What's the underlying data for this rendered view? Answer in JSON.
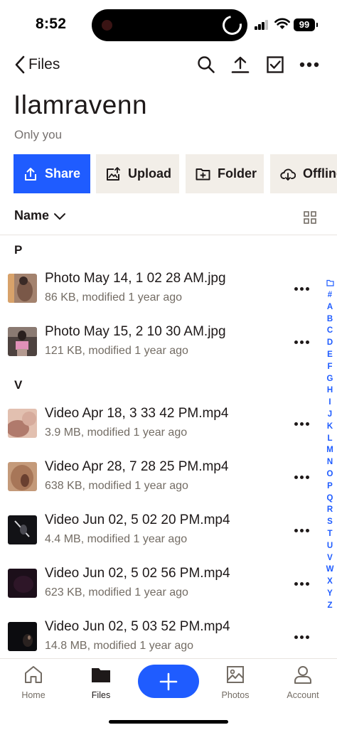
{
  "status_bar": {
    "time": "8:52",
    "battery": "99"
  },
  "nav": {
    "back_label": "Files"
  },
  "folder": {
    "title": "Ilamravenn",
    "subtitle": "Only you"
  },
  "actions": [
    {
      "label": "Share",
      "icon": "share-icon"
    },
    {
      "label": "Upload",
      "icon": "upload-image-icon"
    },
    {
      "label": "Folder",
      "icon": "new-folder-icon"
    },
    {
      "label": "Offline",
      "icon": "offline-download-icon"
    }
  ],
  "sort": {
    "label": "Name"
  },
  "sections": [
    {
      "letter": "P"
    },
    {
      "letter": "V"
    }
  ],
  "files": [
    {
      "name": "Photo May 14, 1 02 28 AM.jpg",
      "meta": "86 KB, modified 1 year ago",
      "thumb_color": "#a3826e"
    },
    {
      "name": "Photo May 15, 2 10 30 AM.jpg",
      "meta": "121 KB, modified 1 year ago",
      "thumb_color": "#6b5a55"
    },
    {
      "name": "Video Apr 18, 3 33 42 PM.mp4",
      "meta": "3.9 MB, modified 1 year ago",
      "thumb_color": "#c39a8a"
    },
    {
      "name": "Video Apr 28, 7 28 25 PM.mp4",
      "meta": "638 KB, modified 1 year ago",
      "thumb_color": "#b58a6c"
    },
    {
      "name": "Video Jun 02, 5 02 20 PM.mp4",
      "meta": "4.4 MB, modified 1 year ago",
      "thumb_color": "#1b1b1f"
    },
    {
      "name": "Video Jun 02, 5 02 56 PM.mp4",
      "meta": "623 KB, modified 1 year ago",
      "thumb_color": "#2a1424"
    },
    {
      "name": "Video Jun 02, 5 03 52 PM.mp4",
      "meta": "14.8 MB, modified 1 year ago",
      "thumb_color": "#141418"
    }
  ],
  "index_letters": [
    "#",
    "A",
    "B",
    "C",
    "D",
    "E",
    "F",
    "G",
    "H",
    "I",
    "J",
    "K",
    "L",
    "M",
    "N",
    "O",
    "P",
    "Q",
    "R",
    "S",
    "T",
    "U",
    "V",
    "W",
    "X",
    "Y",
    "Z"
  ],
  "tabs": [
    {
      "label": "Home",
      "icon": "home-icon"
    },
    {
      "label": "Files",
      "icon": "folder-icon"
    },
    {
      "label": "Photos",
      "icon": "photos-icon"
    },
    {
      "label": "Account",
      "icon": "account-icon"
    }
  ],
  "colors": {
    "accent": "#1f5cff",
    "secondary_button": "#f2eee8",
    "text": "#1e1919",
    "muted_text": "#736c64"
  }
}
